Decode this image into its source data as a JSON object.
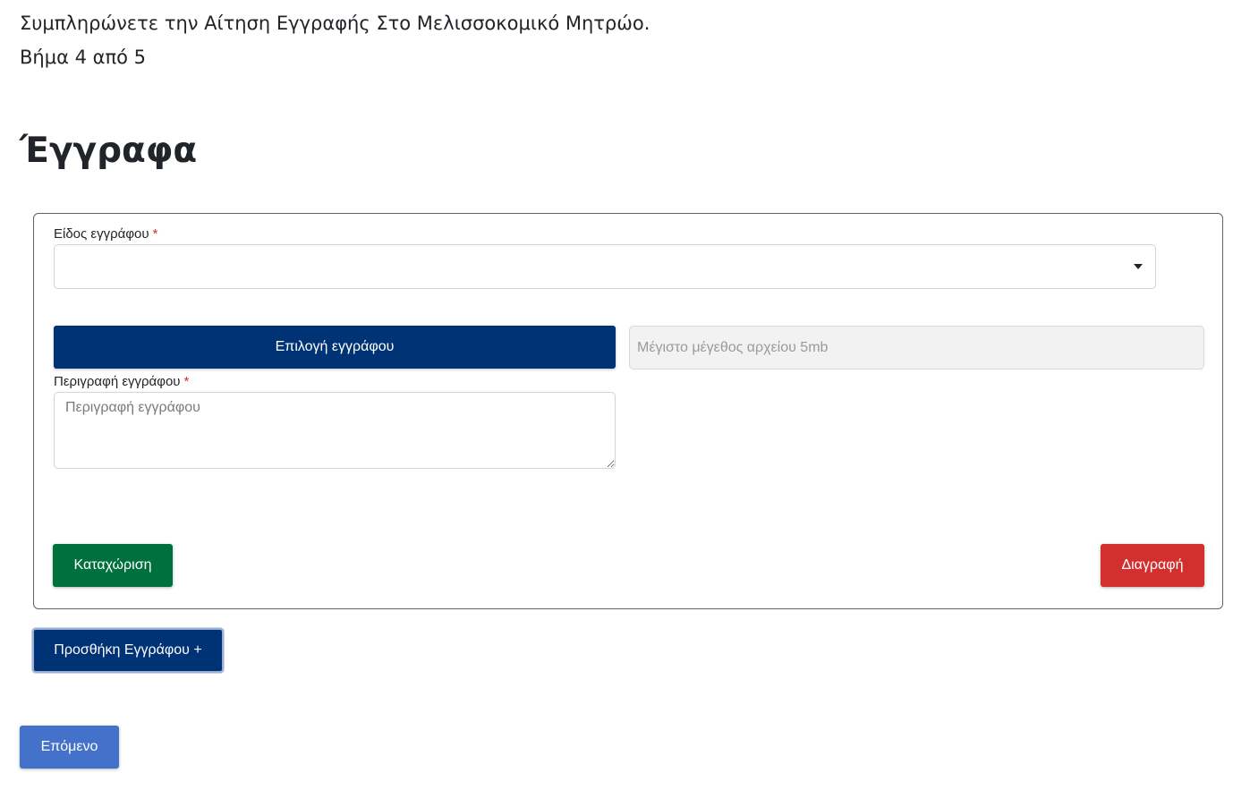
{
  "intro": {
    "title": "Συμπληρώνετε την Αίτηση Εγγραφής Στο Μελισσοκομικό Μητρώο.",
    "step": "Βήμα 4 από 5"
  },
  "page_title": "Έγγραφα",
  "document_form": {
    "doc_type_label": "Είδος εγγράφου",
    "required_marker": "*",
    "doc_type_value": "",
    "choose_file_label": "Επιλογή εγγράφου",
    "file_size_placeholder": "Μέγιστο μέγεθος αρχείου 5mb",
    "description_label": "Περιγραφή εγγράφου",
    "description_placeholder": "Περιγραφή εγγράφου",
    "submit_label": "Καταχώριση",
    "delete_label": "Διαγραφή"
  },
  "add_document_label": "Προσθήκη Εγγράφου +",
  "next_label": "Επόμενο",
  "colors": {
    "primary": "#003375",
    "success": "#00703c",
    "danger": "#d32f2f",
    "next": "#4472ca"
  },
  "icons": {
    "select_arrow": "caret-down-icon"
  }
}
